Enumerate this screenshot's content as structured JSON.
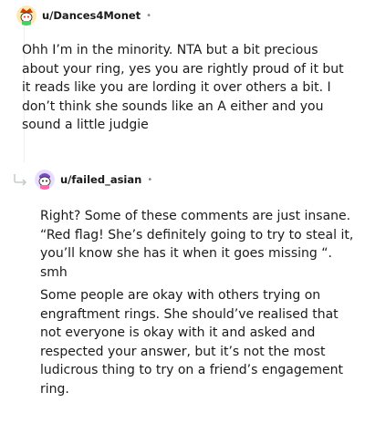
{
  "comments": [
    {
      "username": "u/Dances4Monet",
      "separator": "•",
      "avatar_icon": "snoo-avatar-icon",
      "paragraphs": [
        "Ohh I’m in the minority. NTA but a bit precious about your ring, yes you are rightly proud of it but it reads like you are lording it over others a bit. I don’t think she sounds like an A either and you sound a little judgie"
      ]
    },
    {
      "username": "u/failed_asian",
      "separator": "•",
      "avatar_icon": "snoo-avatar-icon",
      "reply_icon": "reply-arrow-icon",
      "paragraphs": [
        "Right? Some of these comments are just insane. “Red flag! She’s definitely going to try to steal it, you’ll know she has it when it goes missing “. smh",
        "Some people are okay with others trying on engraftment rings. She should’ve realised that not everyone is okay with it and asked and respected your answer, but it’s not the most ludicrous thing to try on a friend’s engagement ring."
      ]
    }
  ],
  "colors": {
    "text": "#1a1a1b",
    "meta": "#878a8c",
    "thread_line": "#edeff1"
  }
}
